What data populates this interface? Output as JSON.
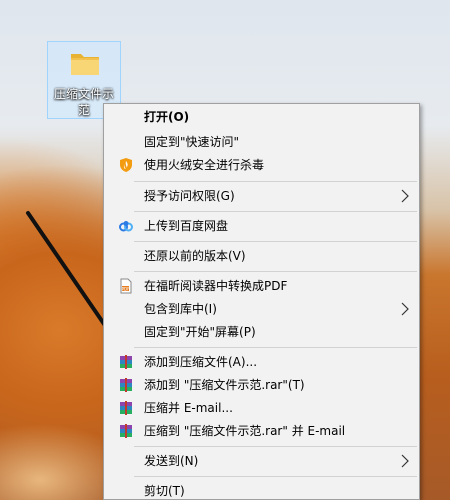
{
  "desktop": {
    "folder_label": "压缩文件示范"
  },
  "menu": {
    "items": [
      {
        "label": "打开(O)"
      },
      {
        "label": "固定到\"快速访问\""
      },
      {
        "label": "使用火绒安全进行杀毒"
      },
      {
        "label": "授予访问权限(G)"
      },
      {
        "label": "上传到百度网盘"
      },
      {
        "label": "还原以前的版本(V)"
      },
      {
        "label": "在福昕阅读器中转换成PDF"
      },
      {
        "label": "包含到库中(I)"
      },
      {
        "label": "固定到\"开始\"屏幕(P)"
      },
      {
        "label": "添加到压缩文件(A)..."
      },
      {
        "label": "添加到 \"压缩文件示范.rar\"(T)"
      },
      {
        "label": "压缩并 E-mail..."
      },
      {
        "label": "压缩到 \"压缩文件示范.rar\" 并 E-mail"
      },
      {
        "label": "发送到(N)"
      },
      {
        "label": "剪切(T)"
      }
    ]
  },
  "icons": {
    "folder": "folder-icon",
    "huorong": "huorong-shield-icon",
    "baidu": "baidu-netdisk-icon",
    "foxit": "foxit-pdf-icon",
    "winrar": "winrar-icon",
    "chevron": "chevron-right-icon"
  },
  "colors": {
    "menu_bg": "#f2f2f2",
    "selection": "#cce8ff"
  }
}
